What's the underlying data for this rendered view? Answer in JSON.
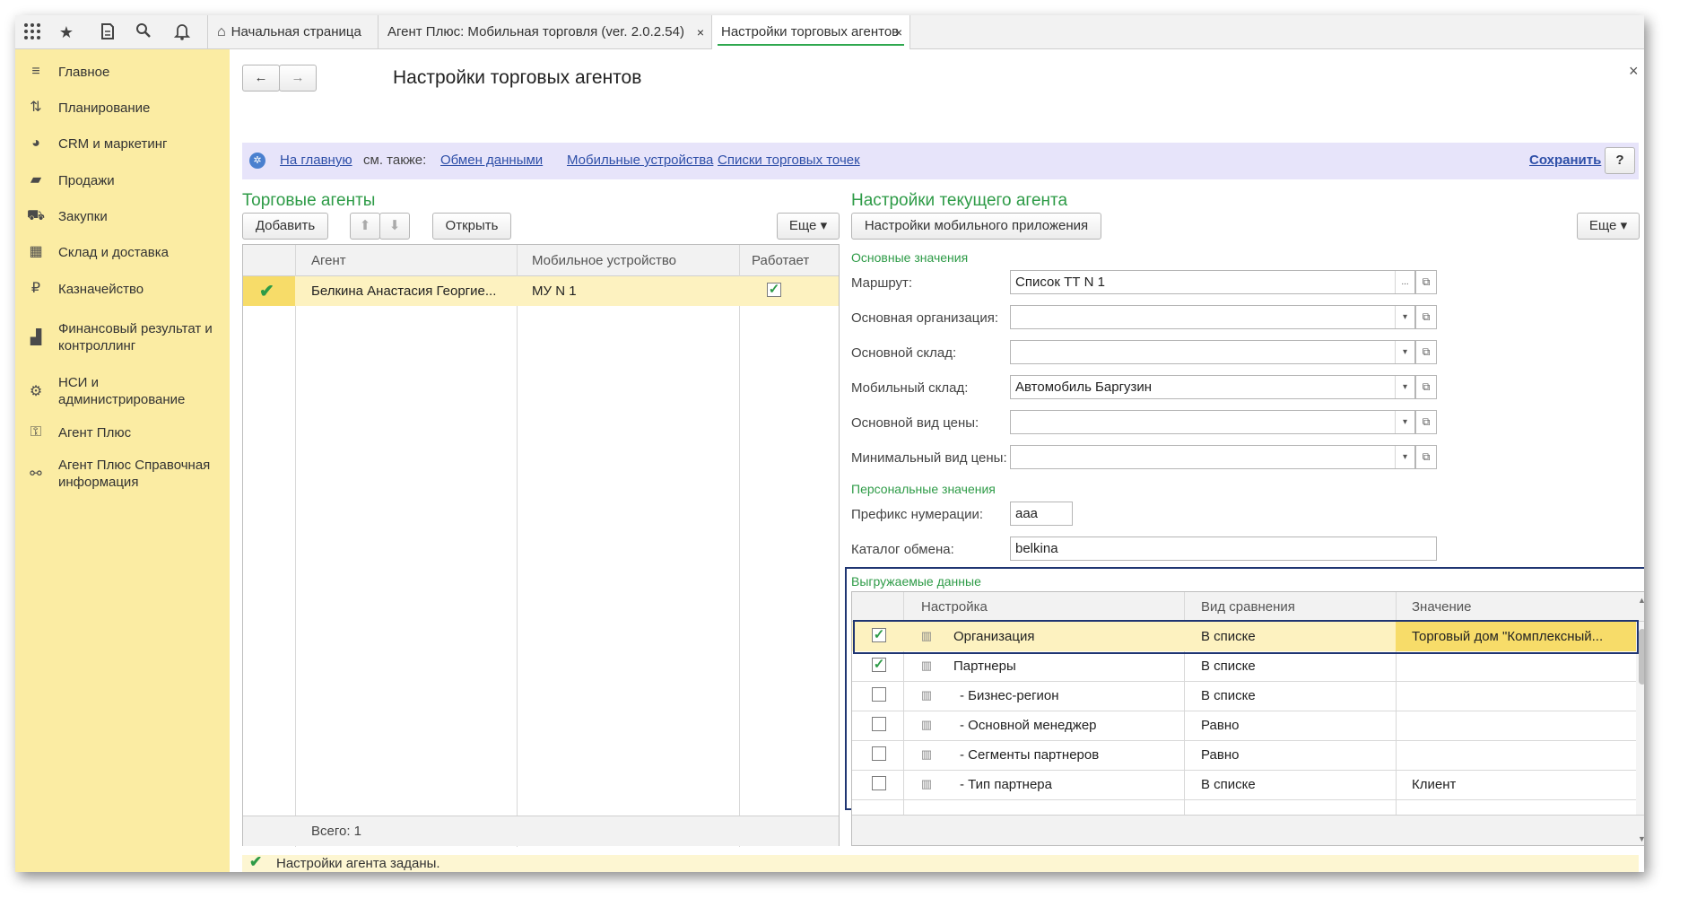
{
  "topbar": {
    "tabs": [
      {
        "label": "Начальная страница"
      },
      {
        "label": "Агент Плюс: Мобильная торговля (ver. 2.0.2.54)",
        "close": "×"
      },
      {
        "label": "Настройки торговых агентов",
        "close": "×"
      }
    ]
  },
  "sidebar": {
    "items": [
      {
        "label": "Главное",
        "icon": "menu-lines-icon"
      },
      {
        "label": "Планирование",
        "icon": "planning-icon"
      },
      {
        "label": "CRM и маркетинг",
        "icon": "pie-chart-icon"
      },
      {
        "label": "Продажи",
        "icon": "shopping-bag-icon"
      },
      {
        "label": "Закупки",
        "icon": "cart-icon"
      },
      {
        "label": "Склад и доставка",
        "icon": "warehouse-icon"
      },
      {
        "label": "Казначейство",
        "icon": "ruble-coin-icon"
      },
      {
        "label": "Финансовый результат и контроллинг",
        "icon": "bar-chart-icon"
      },
      {
        "label": "НСИ и администрирование",
        "icon": "gear-icon"
      },
      {
        "label": "Агент Плюс",
        "icon": "agent-icon"
      },
      {
        "label": "Агент Плюс Справочная информация",
        "icon": "agent-info-icon"
      }
    ]
  },
  "form": {
    "title": "Настройки торговых агентов",
    "close": "×",
    "nav_back": "←",
    "nav_forward": "→"
  },
  "infobar": {
    "home_link": "На главную",
    "see_also": "см. также:",
    "links": [
      "Обмен данными",
      "Мобильные устройства",
      "Списки торговых точек"
    ],
    "save": "Сохранить",
    "help": "?"
  },
  "agents": {
    "title": "Торговые агенты",
    "add_button": "Добавить",
    "open_button": "Открыть",
    "more_button": "Еще",
    "columns": [
      "Агент",
      "Мобильное устройство",
      "Работает"
    ],
    "rows": [
      {
        "agent": "Белкина Анастасия Георгие...",
        "device": "МУ N 1",
        "works": true
      }
    ],
    "footer": "Всего: 1"
  },
  "settings": {
    "title": "Настройки текущего агента",
    "mobile_app_button": "Настройки мобильного приложения",
    "more_button": "Еще",
    "group_main": "Основные значения",
    "fields": [
      {
        "label": "Маршрут:",
        "value": "Список ТТ N 1",
        "btn": "..."
      },
      {
        "label": "Основная организация:",
        "value": "",
        "btn": "▾"
      },
      {
        "label": "Основной склад:",
        "value": "",
        "btn": "▾"
      },
      {
        "label": "Мобильный склад:",
        "value": "Автомобиль Баргузин",
        "btn": "▾"
      },
      {
        "label": "Основной вид цены:",
        "value": "",
        "btn": "▾"
      },
      {
        "label": "Минимальный вид цены:",
        "value": "",
        "btn": "▾"
      }
    ],
    "group_personal": "Персональные значения",
    "prefix_label": "Префикс нумерации:",
    "prefix_value": "aaa",
    "catalog_label": "Каталог обмена:",
    "catalog_value": "belkina",
    "group_export": "Выгружаемые данные",
    "export_columns": [
      "Настройка",
      "Вид сравнения",
      "Значение"
    ],
    "export_rows": [
      {
        "checked": true,
        "name": "Организация",
        "comparison": "В списке",
        "value": "Торговый дом \"Комплексный..."
      },
      {
        "checked": true,
        "name": "Партнеры",
        "comparison": "В списке",
        "value": ""
      },
      {
        "checked": false,
        "name": "- Бизнес-регион",
        "comparison": "В списке",
        "value": ""
      },
      {
        "checked": false,
        "name": "- Основной менеджер",
        "comparison": "Равно",
        "value": ""
      },
      {
        "checked": false,
        "name": "- Сегменты партнеров",
        "comparison": "Равно",
        "value": ""
      },
      {
        "checked": false,
        "name": "- Тип партнера",
        "comparison": "В списке",
        "value": "Клиент"
      }
    ]
  },
  "status": {
    "text": "Настройки агента заданы."
  },
  "colors": {
    "sidebar_bg": "#fbeca3",
    "selected_row": "#fdf2c0",
    "accent_green": "#2e9b47",
    "highlight_frame": "#1f3572",
    "infobar_bg": "#e7e4fa"
  }
}
